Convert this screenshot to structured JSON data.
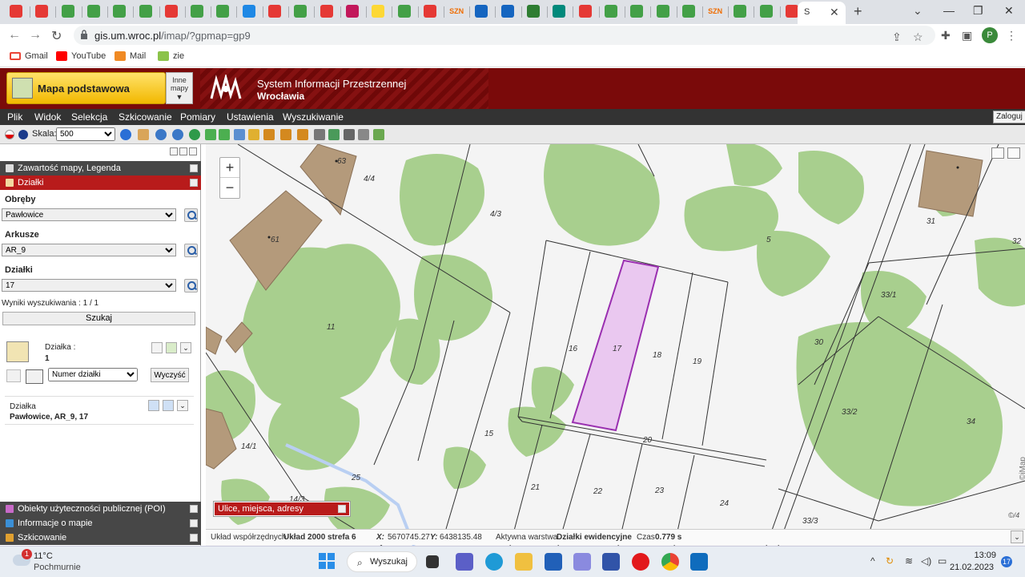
{
  "browser": {
    "active_tab_title": "S",
    "url_host": "gis.um.wroc.pl",
    "url_path": "/imap/?gpmap=gp9",
    "profile_initial": "P",
    "bookmarks": [
      "Gmail",
      "YouTube",
      "Mail",
      "zie"
    ],
    "tab_icon_colors": [
      "#e53935",
      "#e53935",
      "#43a047",
      "#43a047",
      "#43a047",
      "#43a047",
      "#e53935",
      "#43a047",
      "#43a047",
      "#1e88e5",
      "#e53935",
      "#43a047",
      "#e53935",
      "#c2185b",
      "#fdd835",
      "#43a047",
      "#e53935",
      "#ef6c00",
      "#1565c0",
      "#1565c0",
      "#2e7d32",
      "#00897b",
      "#e53935",
      "#43a047",
      "#43a047",
      "#43a047",
      "#43a047",
      "#ef6c00",
      "#43a047",
      "#43a047",
      "#e53935",
      "#9e9e9e"
    ],
    "tab_icon_texts": [
      "SZN",
      "SZN"
    ]
  },
  "app": {
    "map_button": "Mapa podstawowa",
    "other_maps_1": "Inne",
    "other_maps_2": "mapy",
    "system_title_1": "System Informacji Przestrzennej",
    "system_title_2": "Wrocławia",
    "menu": [
      "Plik",
      "Widok",
      "Selekcja",
      "Szkicowanie",
      "Pomiary",
      "Ustawienia",
      "Wyszukiwanie"
    ],
    "login": "Zaloguj",
    "scale_label": "Skala:",
    "scale_value": "500"
  },
  "panel": {
    "section_legend": "Zawartość mapy, Legenda",
    "section_parcels": "Działki",
    "label_precinct": "Obręby",
    "value_precinct": "Pawłowice",
    "label_sheets": "Arkusze",
    "value_sheets": "AR_9",
    "label_parcels": "Działki",
    "value_parcels": "17",
    "results": "Wyniki wyszukiwania : 1 / 1",
    "search_button": "Szukaj",
    "parcel_count_label": "Działka :",
    "parcel_count": "1",
    "sort_option": "Numer działki",
    "clear_button": "Wyczyść",
    "result_label": "Działka",
    "result_value": "Pawłowice, AR_9, 17",
    "section_poi": "Obiekty użyteczności publicznej (POI)",
    "section_info": "Informacje o mapie",
    "section_sketch": "Szkicowanie"
  },
  "map": {
    "zoom_in": "+",
    "zoom_out": "−",
    "streets_box": "Ulice, miejsca, adresy",
    "side_label": "©iMap",
    "scale_mark": "©/4",
    "parcel_labels": [
      "4/4",
      "4/3",
      "63",
      "61",
      "11",
      "16",
      "17",
      "18",
      "19",
      "5",
      "31",
      "32",
      "33/1",
      "30",
      "33/2",
      "34",
      "15",
      "20",
      "21",
      "22",
      "23",
      "24",
      "25",
      "14/1",
      "14/3",
      "33/3"
    ],
    "selected_parcel": "17",
    "colors": {
      "vegetation": "#a8cf8e",
      "building": "#b49a7b",
      "selected_fill": "#eac8f0",
      "selected_stroke": "#9a2fb0"
    }
  },
  "status": {
    "coord_system_label": "Układ współrzędnych",
    "coord_system": "Układ 2000 strefa 6",
    "x_label": "X:",
    "x_value": "5670745.27",
    "y_label": "Y:",
    "y_value": "6438135.48",
    "layer_label": "Aktywna warstwa",
    "layer_value": "Działki ewidencyjne",
    "time_label": "Czas",
    "time_value": "0.779 s"
  },
  "taskbar": {
    "temperature": "11°C",
    "condition": "Pochmurnie",
    "weather_badge": "1",
    "search": "Wyszukaj",
    "time": "13:09",
    "date": "21.02.2023",
    "notif_count": "17"
  }
}
